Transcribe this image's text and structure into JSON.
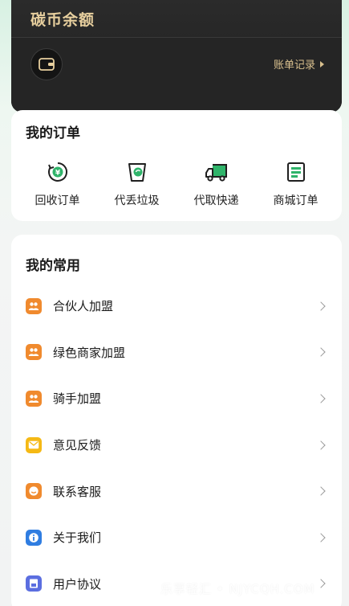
{
  "wallet": {
    "title": "碳币余额",
    "record_label": "账单记录"
  },
  "orders": {
    "title": "我的订单",
    "items": [
      {
        "label": "回收订单",
        "icon": "recycle-coin-icon"
      },
      {
        "label": "代丢垃圾",
        "icon": "trash-bin-icon"
      },
      {
        "label": "代取快递",
        "icon": "delivery-truck-icon"
      },
      {
        "label": "商城订单",
        "icon": "shop-order-icon"
      }
    ]
  },
  "common": {
    "title": "我的常用",
    "items": [
      {
        "label": "合伙人加盟",
        "icon": "partner-icon",
        "color": "#f08a2e"
      },
      {
        "label": "绿色商家加盟",
        "icon": "merchant-icon",
        "color": "#f08a2e"
      },
      {
        "label": "骑手加盟",
        "icon": "rider-icon",
        "color": "#f08a2e"
      },
      {
        "label": "意见反馈",
        "icon": "mail-icon",
        "color": "#f5b915"
      },
      {
        "label": "联系客服",
        "icon": "service-icon",
        "color": "#f08a2e"
      },
      {
        "label": "关于我们",
        "icon": "info-icon",
        "color": "#2f7de1"
      },
      {
        "label": "用户协议",
        "icon": "agreement-icon",
        "color": "#5b6ee0"
      }
    ]
  },
  "watermark": "乐享轻汇 • NJYCQH.COM",
  "colors": {
    "accent_gold": "#e7cf9e",
    "orange": "#f08a2e",
    "yellow": "#f5b915",
    "blue": "#2f7de1",
    "green": "#2fb46a"
  }
}
